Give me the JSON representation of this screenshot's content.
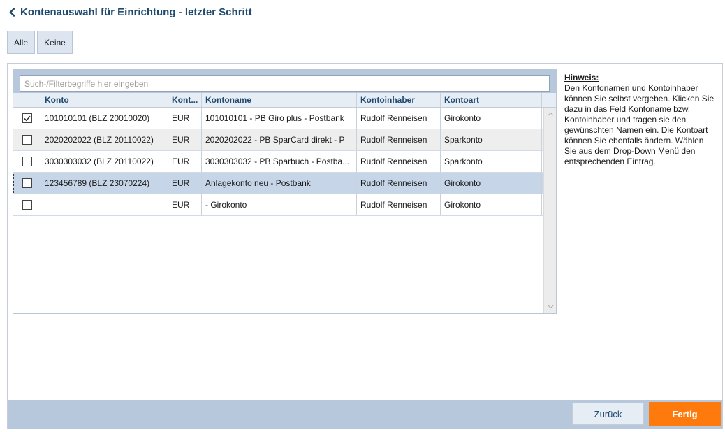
{
  "header": {
    "title": "Kontenauswahl für Einrichtung - letzter Schritt"
  },
  "selection": {
    "all_label": "Alle",
    "none_label": "Keine"
  },
  "search": {
    "placeholder": "Such-/Filterbegriffe hier eingeben",
    "value": ""
  },
  "table": {
    "columns": [
      "Konto",
      "Kont...",
      "Kontoname",
      "Kontoinhaber",
      "Kontoart"
    ],
    "rows": [
      {
        "checked": true,
        "konto": "101010101 (BLZ 20010020)",
        "waehrung": "EUR",
        "kontoname": "101010101 - PB Giro plus - Postbank",
        "inhaber": "Rudolf Renneisen",
        "kontoart": "Girokonto"
      },
      {
        "checked": false,
        "konto": "2020202022 (BLZ 20110022)",
        "waehrung": "EUR",
        "kontoname": "2020202022 - PB SparCard direkt - P",
        "inhaber": "Rudolf Renneisen",
        "kontoart": "Sparkonto"
      },
      {
        "checked": false,
        "konto": "3030303032 (BLZ 20110022)",
        "waehrung": "EUR",
        "kontoname": "3030303032 - PB Sparbuch - Postba...",
        "inhaber": "Rudolf Renneisen",
        "kontoart": "Sparkonto"
      },
      {
        "checked": false,
        "konto": "123456789 (BLZ 23070224)",
        "waehrung": "EUR",
        "kontoname": "Anlagekonto neu - Postbank",
        "inhaber": "Rudolf Renneisen",
        "kontoart": "Girokonto"
      },
      {
        "checked": false,
        "konto": "",
        "waehrung": "EUR",
        "kontoname": " - Girokonto",
        "inhaber": "Rudolf Renneisen",
        "kontoart": "Girokonto"
      }
    ]
  },
  "hint": {
    "title": "Hinweis:",
    "text": "Den Kontonamen und Kontoinhaber können Sie selbst vergeben. Klicken Sie dazu in das Feld Kontoname bzw. Kontoinhaber und tragen sie den gewünschten Namen ein. Die Kontoart können Sie ebenfalls ändern. Wählen Sie aus dem Drop-Down Menü den entsprechenden Eintrag."
  },
  "footer": {
    "back_label": "Zurück",
    "finish_label": "Fertig"
  },
  "colors": {
    "accent": "#ff7a0d",
    "title": "#1f4a6e",
    "bar": "#b8c8dc"
  }
}
